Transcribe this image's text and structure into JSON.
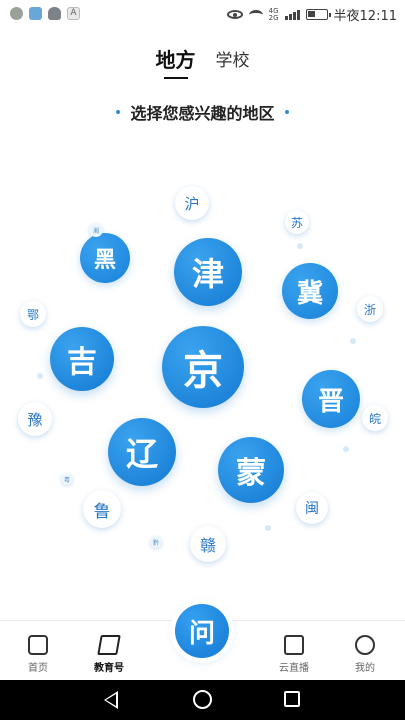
{
  "status": {
    "time": "半夜12:11",
    "network": [
      "4G",
      "2G"
    ],
    "font_icon": "A"
  },
  "tabs": {
    "active": "地方",
    "other": "学校"
  },
  "subtitle": "选择您感兴趣的地区",
  "regions": {
    "jing": "京",
    "jin": "津",
    "ji": "冀",
    "jin2": "晋",
    "meng": "蒙",
    "liao": "辽",
    "ji2": "吉",
    "hei": "黑",
    "hu": "沪",
    "su": "苏",
    "zhe": "浙",
    "wan": "皖",
    "min": "闽",
    "gan": "赣",
    "lu": "鲁",
    "yu": "豫",
    "e": "鄂",
    "xiang": "湘",
    "yue": "粤",
    "qian": "黔"
  },
  "nav": {
    "home": "首页",
    "edu": "教育号",
    "ask": "问",
    "live": "云直播",
    "me": "我的"
  },
  "colors": {
    "accent": "#1479d2",
    "accent_light": "#3aa3ef"
  }
}
